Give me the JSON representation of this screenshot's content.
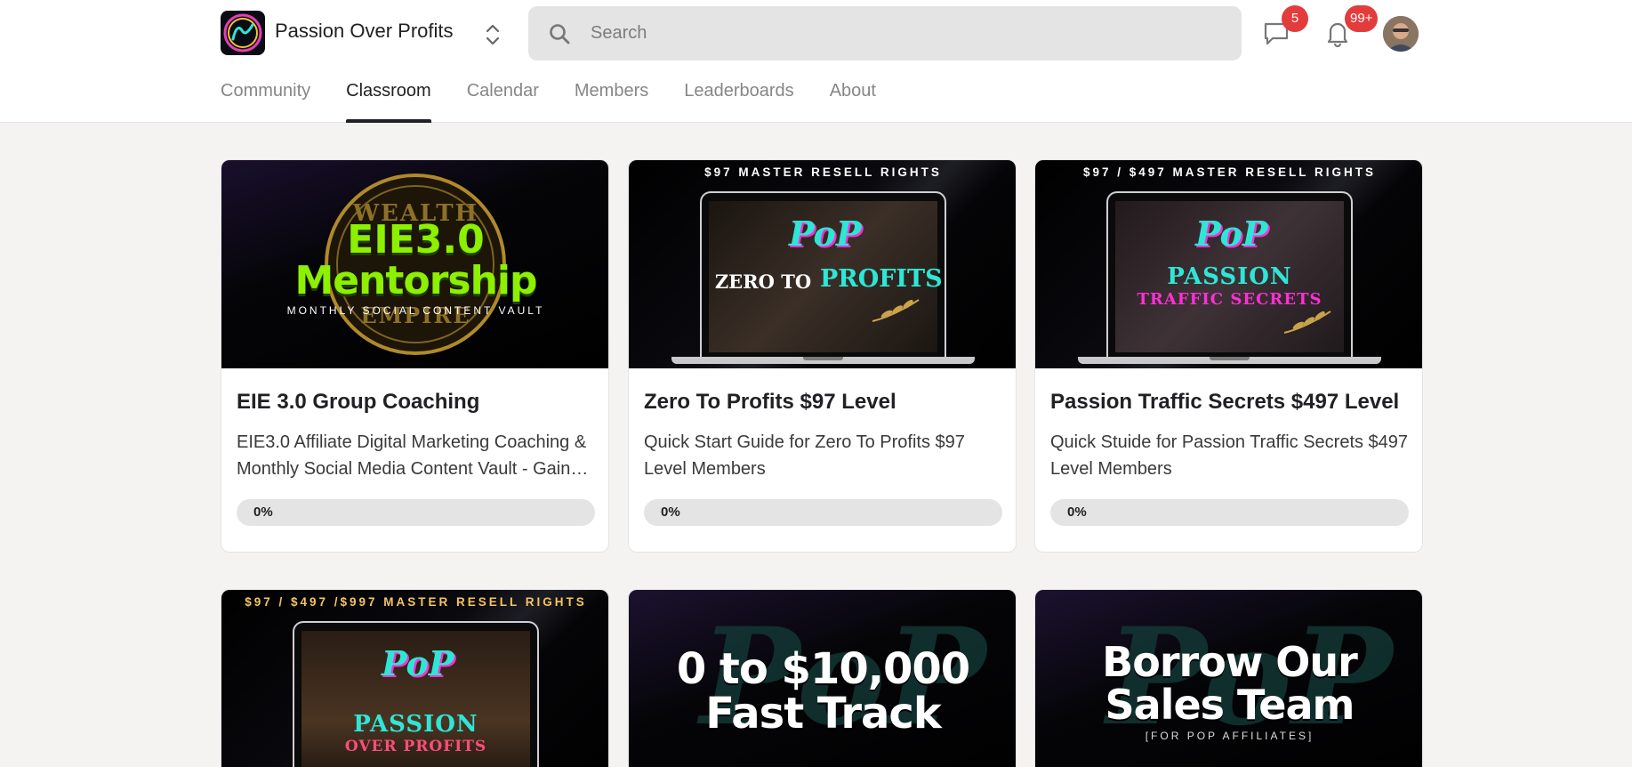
{
  "header": {
    "group_name": "Passion Over Profits",
    "search_placeholder": "Search",
    "chat_badge": "5",
    "notification_badge": "99+"
  },
  "tabs": [
    {
      "label": "Community",
      "active": false
    },
    {
      "label": "Classroom",
      "active": true
    },
    {
      "label": "Calendar",
      "active": false
    },
    {
      "label": "Members",
      "active": false
    },
    {
      "label": "Leaderboards",
      "active": false
    },
    {
      "label": "About",
      "active": false
    }
  ],
  "courses": [
    {
      "thumbnail": {
        "headline_1": "EIE3.0",
        "headline_2": "Mentorship",
        "subline": "MONTHLY SOCIAL CONTENT VAULT",
        "seal_text_top": "WEALTH",
        "seal_text_bottom": "EMPIRE"
      },
      "title": "EIE 3.0 Group Coaching",
      "description": "EIE3.0 Affiliate Digital Marketing Coaching & Monthly Social Media Content Vault - Gain a...",
      "progress_label": "0%",
      "progress": 0
    },
    {
      "thumbnail": {
        "banner": "$97 MASTER RESELL RIGHTS",
        "logo": "PoP",
        "product_prefix": "ZERO TO",
        "product_name": "PROFITS"
      },
      "title": "Zero To Profits $97 Level",
      "description": "Quick Start Guide for Zero To Profits $97 Level Members",
      "progress_label": "0%",
      "progress": 0
    },
    {
      "thumbnail": {
        "banner": "$97 / $497 MASTER RESELL RIGHTS",
        "logo": "PoP",
        "product_line_1": "PASSION",
        "product_line_2": "TRAFFIC SECRETS"
      },
      "title": "Passion Traffic Secrets $497 Level",
      "description": "Quick Stuide for Passion Traffic Secrets $497 Level Members",
      "progress_label": "0%",
      "progress": 0
    },
    {
      "thumbnail": {
        "banner": "$97 / $497 /$997 MASTER RESELL RIGHTS",
        "logo": "PoP",
        "product_line_1": "PASSION",
        "product_line_2": "OVER PROFITS"
      }
    },
    {
      "thumbnail": {
        "line_1": "0 to $10,000",
        "line_2": "Fast Track"
      }
    },
    {
      "thumbnail": {
        "line_1": "Borrow Our",
        "line_2": "Sales Team",
        "subline": "[FOR POP AFFILIATES]"
      }
    }
  ],
  "colors": {
    "accent_dark": "#202124",
    "badge_red": "#e23c3c",
    "tab_inactive": "#868686",
    "lime": "#8cf000",
    "teal": "#2ee6d6",
    "magenta": "#ff2fd6"
  }
}
